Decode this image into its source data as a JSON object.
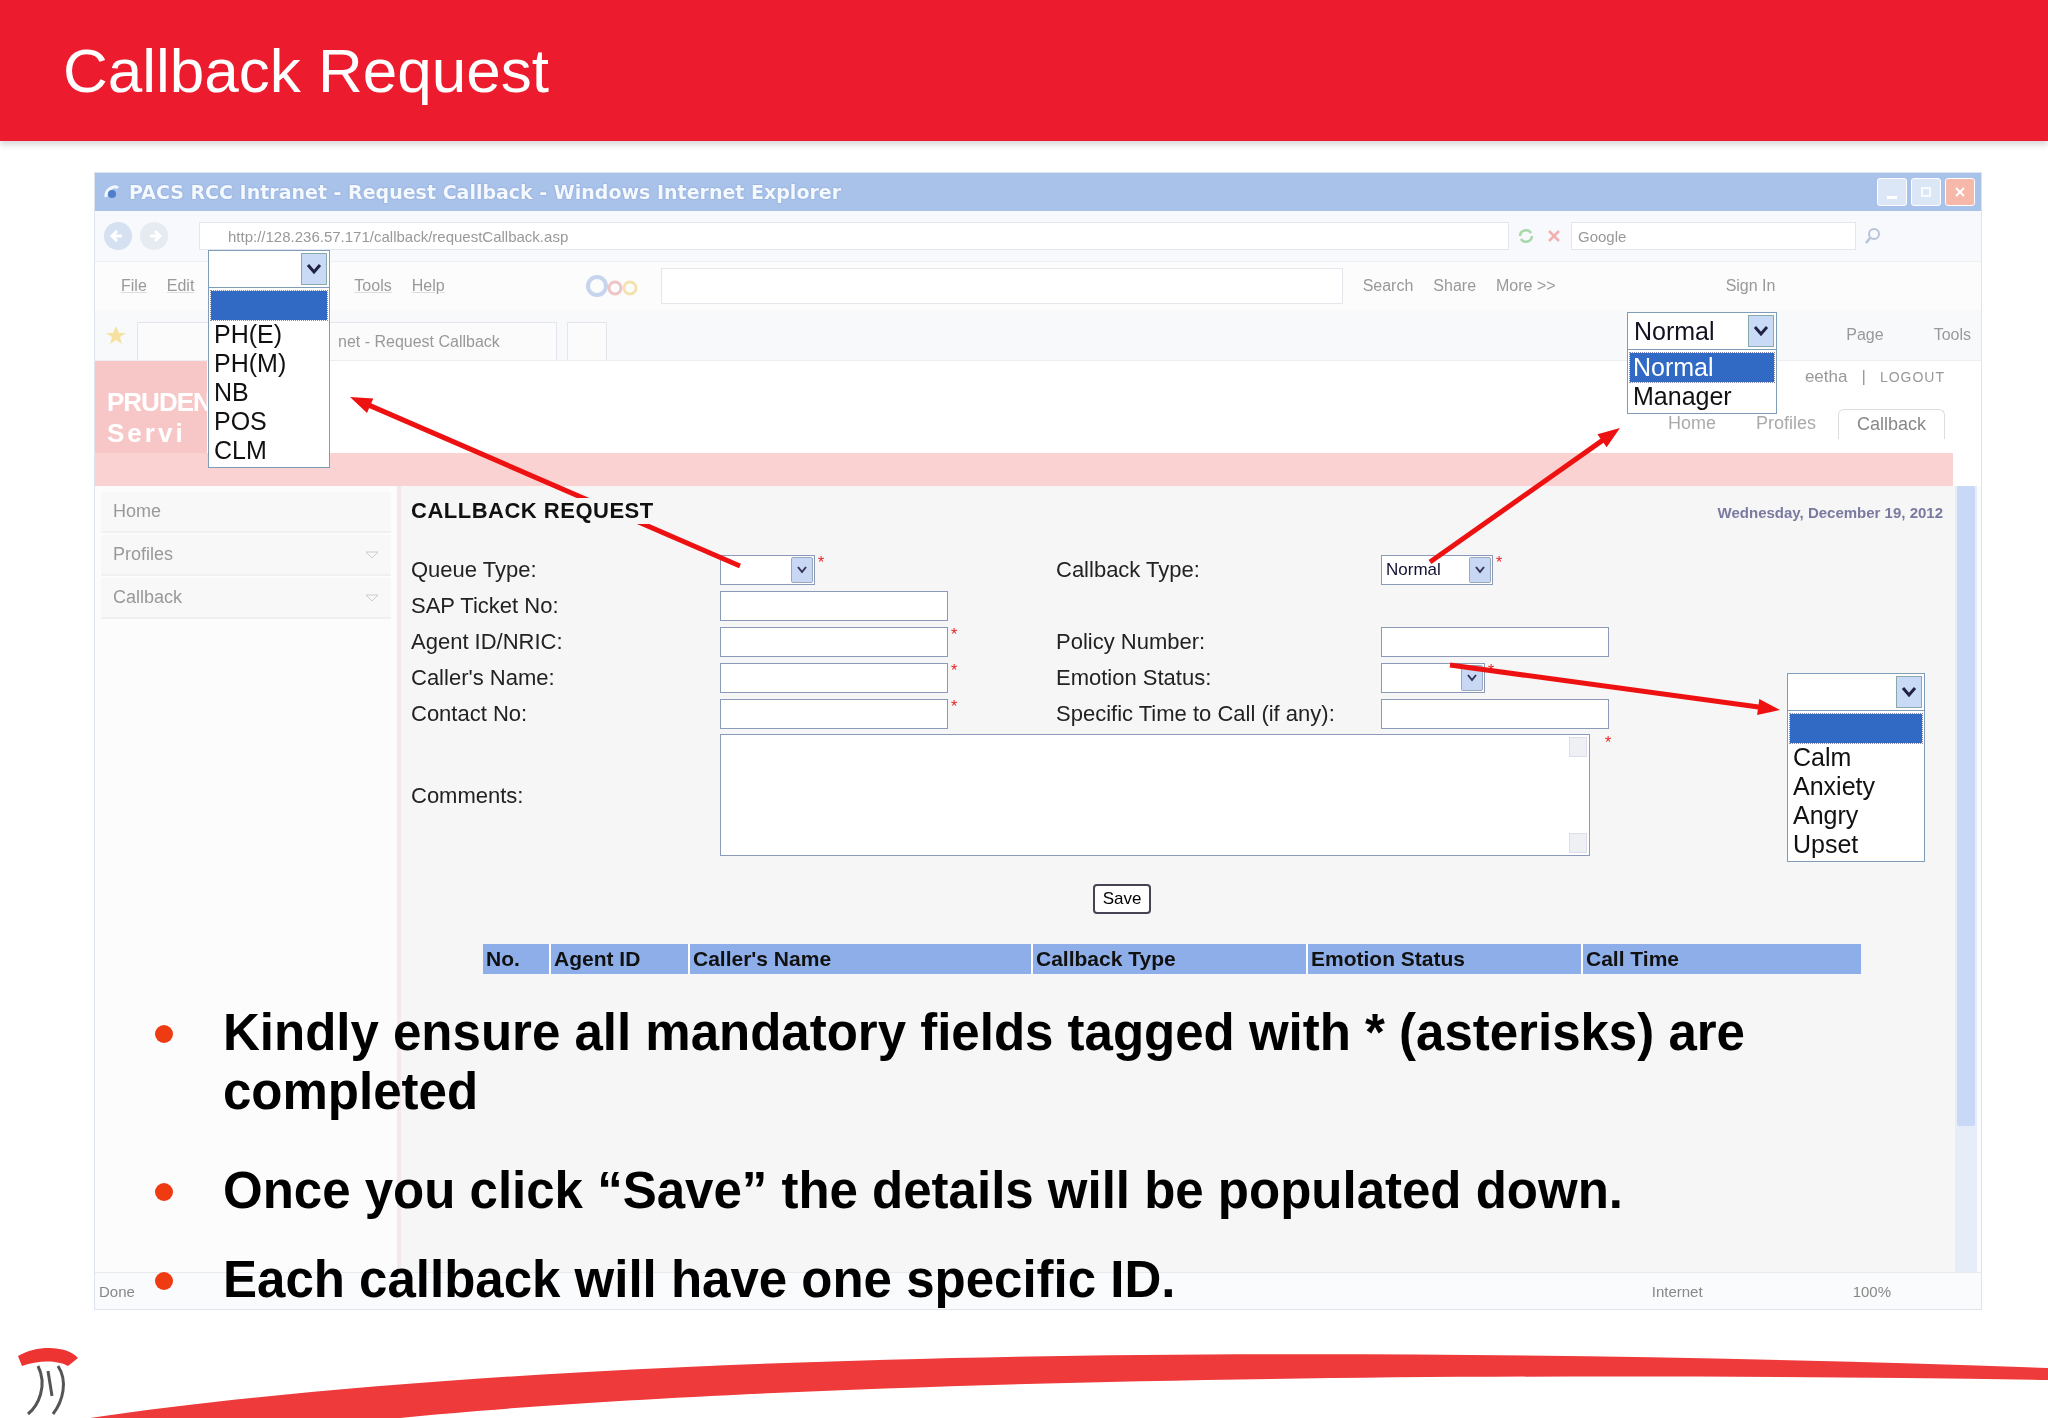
{
  "slide": {
    "title": "Callback Request"
  },
  "browser": {
    "title": "PACS RCC Intranet - Request Callback - Windows Internet Explorer",
    "address": "http://128.236.57.171/callback/requestCallback.asp",
    "search_placeholder": "Google",
    "menu": [
      "File",
      "Edit",
      "Tools",
      "Help"
    ],
    "toolbar": [
      "Search",
      "Share",
      "More >>",
      "Sign In"
    ],
    "tab": "net - Request Callback",
    "command_bar": [
      "Page",
      "Tools"
    ],
    "logo_text": [
      "PRUDEN",
      "Servi"
    ],
    "user": "eetha",
    "user_separator": "|",
    "logout": "LOGOUT",
    "nav_tabs": [
      {
        "label": "Home",
        "selected": false
      },
      {
        "label": "Profiles",
        "selected": false
      },
      {
        "label": "Callback",
        "selected": true
      }
    ],
    "sidebar": [
      {
        "label": "Home",
        "expandable": false
      },
      {
        "label": "Profiles",
        "expandable": true
      },
      {
        "label": "Callback",
        "expandable": true
      }
    ],
    "page_heading": "CALLBACK REQUEST",
    "date": "Wednesday, December 19, 2012",
    "required_mark": "*",
    "form_left": [
      {
        "label": "Queue Type:",
        "kind": "select",
        "required": true
      },
      {
        "label": "SAP Ticket No:",
        "kind": "text"
      },
      {
        "label": "Agent ID/NRIC:",
        "kind": "text",
        "required": true
      },
      {
        "label": "Caller's Name:",
        "kind": "text",
        "required": true
      },
      {
        "label": "Contact No:",
        "kind": "text",
        "required": true
      }
    ],
    "form_right": [
      {
        "label": "Callback Type:",
        "kind": "select",
        "value": "Normal",
        "required": true
      },
      {
        "kind": "none"
      },
      {
        "label": "Policy Number:",
        "kind": "text"
      },
      {
        "label": "Emotion Status:",
        "kind": "select",
        "required": true
      },
      {
        "label": "Specific Time to Call (if any):",
        "kind": "text"
      }
    ],
    "comments": {
      "label": "Comments:",
      "required": true
    },
    "save_button": "Save",
    "table": {
      "columns": [
        "No.",
        "Agent ID",
        "Caller's Name",
        "Callback Type",
        "Emotion Status",
        "Call Time"
      ]
    },
    "status_bar": {
      "text": "Done",
      "zone": "Internet",
      "zoom": "100%"
    }
  },
  "popups": [
    {
      "kind": "queue",
      "options": [
        {
          "selected": true
        },
        {
          "label": "PH(E)",
          "selected": false
        },
        {
          "label": "PH(M)",
          "selected": false
        },
        {
          "label": "NB",
          "selected": false
        },
        {
          "label": "POS",
          "selected": false
        },
        {
          "label": "CLM",
          "selected": false
        }
      ]
    },
    {
      "kind": "callback",
      "value": "Normal",
      "options": [
        {
          "label": "Normal",
          "selected": true
        },
        {
          "label": "Manager",
          "selected": false
        }
      ]
    },
    {
      "kind": "emotion",
      "options": [
        {
          "selected": true
        },
        {
          "label": "Calm",
          "selected": false
        },
        {
          "label": "Anxiety",
          "selected": false
        },
        {
          "label": "Angry",
          "selected": false
        },
        {
          "label": "Upset",
          "selected": false
        }
      ]
    }
  ],
  "bullets": [
    "Kindly ensure all mandatory fields tagged with * (asterisks) are completed",
    "Once you click “Save” the details will be populated down.",
    "Each callback will have one specific ID."
  ]
}
